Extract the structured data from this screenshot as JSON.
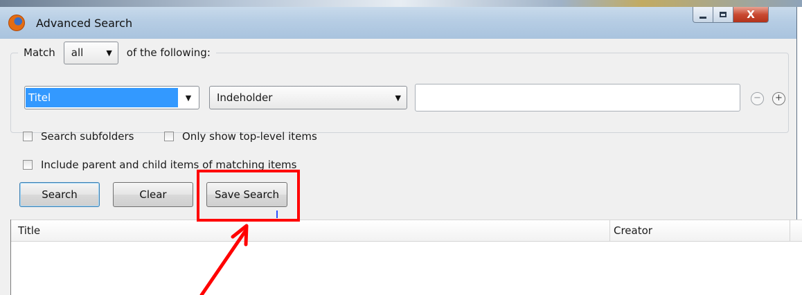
{
  "window": {
    "title": "Advanced Search",
    "close_glyph": "X"
  },
  "match": {
    "label": "Match",
    "selected": "all",
    "suffix": "of the following:"
  },
  "condition": {
    "field": "Titel",
    "operator": "Indeholder",
    "value": ""
  },
  "condition_buttons": {
    "remove": "−",
    "add": "+"
  },
  "options": {
    "search_subfolders": {
      "label": "Search subfolders",
      "checked": false
    },
    "only_top_level": {
      "label": "Only show top-level items",
      "checked": false
    },
    "include_parent_child": {
      "label": "Include parent and child items of matching items",
      "checked": false
    }
  },
  "buttons": {
    "search": "Search",
    "clear": "Clear",
    "save_search": "Save Search"
  },
  "results": {
    "columns": [
      "Title",
      "Creator"
    ]
  },
  "annotation": {
    "highlight_color": "#ff0000"
  },
  "icons": [
    "firefox-app-icon",
    "minimize-icon",
    "maximize-icon",
    "close-icon",
    "dropdown-arrow-icon",
    "remove-condition-icon",
    "add-condition-icon",
    "checkbox-icon"
  ]
}
